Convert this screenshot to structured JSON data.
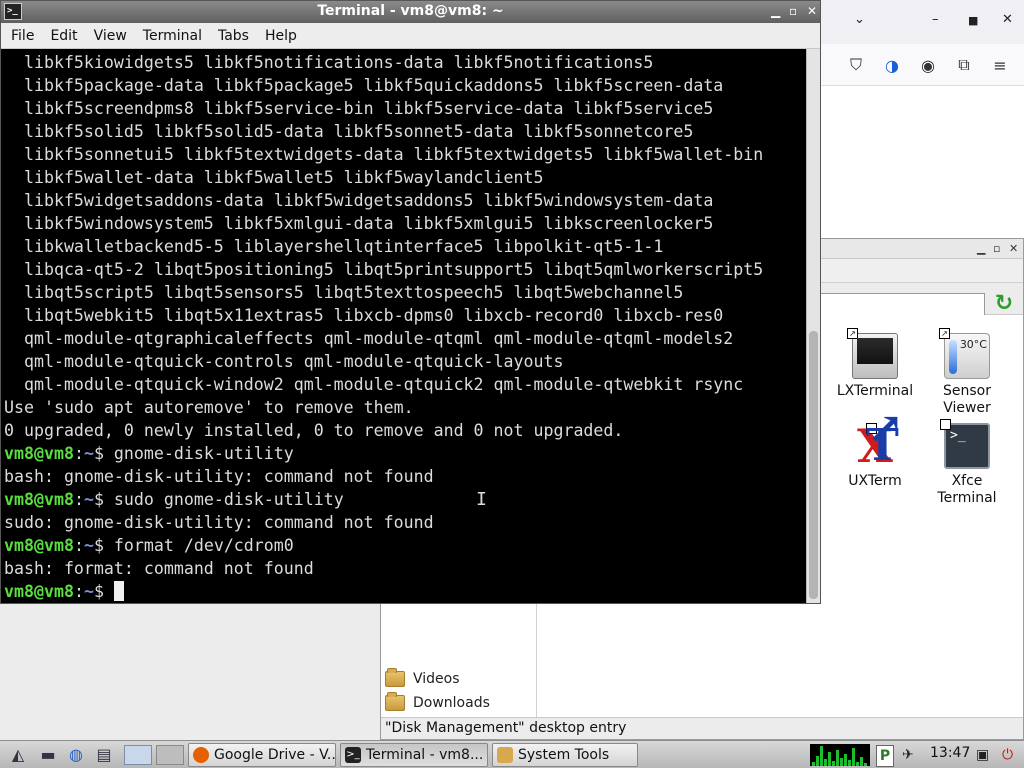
{
  "terminal": {
    "title": "Terminal - vm8@vm8: ~",
    "icon_text": ">_",
    "menu": [
      "File",
      "Edit",
      "View",
      "Terminal",
      "Tabs",
      "Help"
    ],
    "lines": [
      {
        "type": "out",
        "text": "  libkf5kiowidgets5 libkf5notifications-data libkf5notifications5"
      },
      {
        "type": "out",
        "text": "  libkf5package-data libkf5package5 libkf5quickaddons5 libkf5screen-data"
      },
      {
        "type": "out",
        "text": "  libkf5screendpms8 libkf5service-bin libkf5service-data libkf5service5"
      },
      {
        "type": "out",
        "text": "  libkf5solid5 libkf5solid5-data libkf5sonnet5-data libkf5sonnetcore5"
      },
      {
        "type": "out",
        "text": "  libkf5sonnetui5 libkf5textwidgets-data libkf5textwidgets5 libkf5wallet-bin"
      },
      {
        "type": "out",
        "text": "  libkf5wallet-data libkf5wallet5 libkf5waylandclient5"
      },
      {
        "type": "out",
        "text": "  libkf5widgetsaddons-data libkf5widgetsaddons5 libkf5windowsystem-data"
      },
      {
        "type": "out",
        "text": "  libkf5windowsystem5 libkf5xmlgui-data libkf5xmlgui5 libkscreenlocker5"
      },
      {
        "type": "out",
        "text": "  libkwalletbackend5-5 liblayershellqtinterface5 libpolkit-qt5-1-1"
      },
      {
        "type": "out",
        "text": "  libqca-qt5-2 libqt5positioning5 libqt5printsupport5 libqt5qmlworkerscript5"
      },
      {
        "type": "out",
        "text": "  libqt5script5 libqt5sensors5 libqt5texttospeech5 libqt5webchannel5"
      },
      {
        "type": "out",
        "text": "  libqt5webkit5 libqt5x11extras5 libxcb-dpms0 libxcb-record0 libxcb-res0"
      },
      {
        "type": "out",
        "text": "  qml-module-qtgraphicaleffects qml-module-qtqml qml-module-qtqml-models2"
      },
      {
        "type": "out",
        "text": "  qml-module-qtquick-controls qml-module-qtquick-layouts"
      },
      {
        "type": "out",
        "text": "  qml-module-qtquick-window2 qml-module-qtquick2 qml-module-qtwebkit rsync"
      },
      {
        "type": "out",
        "text": "Use 'sudo apt autoremove' to remove them."
      },
      {
        "type": "out",
        "text": "0 upgraded, 0 newly installed, 0 to remove and 0 not upgraded."
      },
      {
        "type": "prompt",
        "user": "vm8@vm8",
        "sep": ":",
        "path": "~",
        "sym": "$ ",
        "cmd": "gnome-disk-utility"
      },
      {
        "type": "out",
        "text": "bash: gnome-disk-utility: command not found"
      },
      {
        "type": "prompt",
        "user": "vm8@vm8",
        "sep": ":",
        "path": "~",
        "sym": "$ ",
        "cmd": "sudo gnome-disk-utility"
      },
      {
        "type": "out",
        "text": "sudo: gnome-disk-utility: command not found"
      },
      {
        "type": "prompt",
        "user": "vm8@vm8",
        "sep": ":",
        "path": "~",
        "sym": "$ ",
        "cmd": "format /dev/cdrom0"
      },
      {
        "type": "out",
        "text": "bash: format: command not found"
      },
      {
        "type": "prompt",
        "user": "vm8@vm8",
        "sep": ":",
        "path": "~",
        "sym": "$ ",
        "cmd": "",
        "cursor": true
      }
    ]
  },
  "file_manager": {
    "sidebar": [
      {
        "label": "Videos",
        "icon": "folder-icon"
      },
      {
        "label": "Downloads",
        "icon": "folder-icon"
      }
    ],
    "icons": [
      {
        "label": "LXTerminal",
        "icon": "lxterminal-icon"
      },
      {
        "label": "Sensor Viewer",
        "icon": "sensor-viewer-icon",
        "badge": "30°C"
      },
      {
        "label": "UXTerm",
        "icon": "uxterm-icon"
      },
      {
        "label": "Xfce Terminal",
        "icon": "xfce-terminal-icon"
      }
    ],
    "status": "\"Disk Management\" desktop entry"
  },
  "taskbar": {
    "tasks": [
      {
        "label": "Google Drive - V...",
        "icon": "firefox-icon",
        "color": "#e66000"
      },
      {
        "label": "Terminal - vm8...",
        "icon": "terminal-icon",
        "color": "#222222"
      },
      {
        "label": "System Tools",
        "icon": "folder-icon",
        "color": "#d7a84c"
      }
    ],
    "clock": "13:47"
  }
}
